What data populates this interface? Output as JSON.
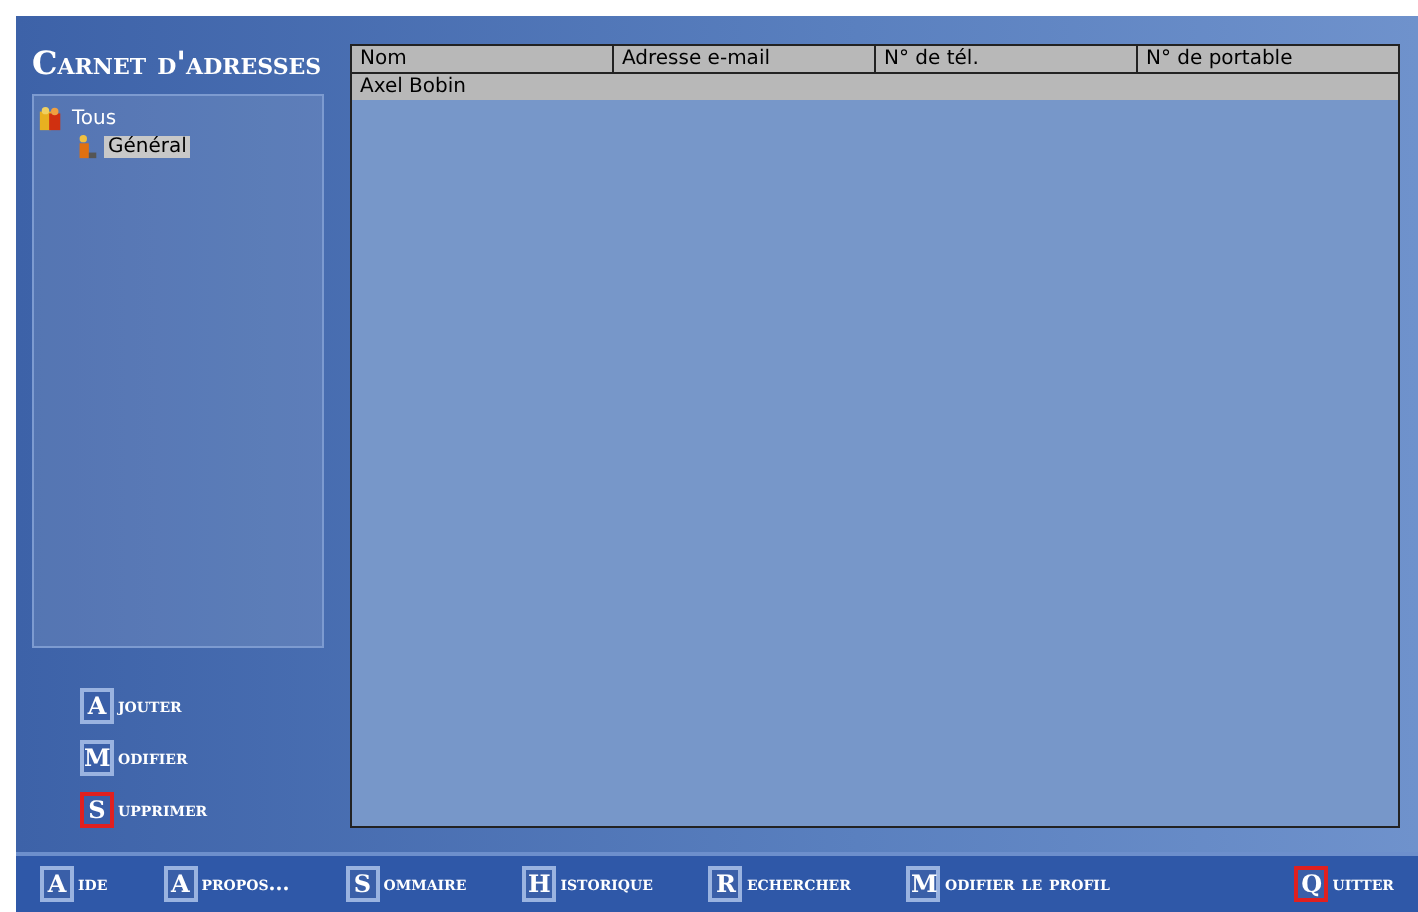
{
  "title": "Carnet d'adresses",
  "tree": [
    {
      "label": "Tous",
      "selected": false,
      "children": [
        {
          "label": "Général",
          "selected": true
        }
      ]
    }
  ],
  "actions": [
    {
      "key": "A",
      "rest": "jouter",
      "kind": "normal"
    },
    {
      "key": "M",
      "rest": "odifier",
      "kind": "normal"
    },
    {
      "key": "S",
      "rest": "upprimer",
      "kind": "danger"
    }
  ],
  "table": {
    "columns": [
      "Nom",
      "Adresse e-mail",
      "N° de tél.",
      "N° de portable"
    ],
    "rows": [
      {
        "cells": [
          "Axel Bobin",
          "",
          "",
          ""
        ],
        "selected": true
      }
    ]
  },
  "bottom_bar": [
    {
      "key": "A",
      "rest": "ide",
      "kind": "normal"
    },
    {
      "key": "A",
      "rest": "propos...",
      "kind": "normal"
    },
    {
      "key": "S",
      "rest": "ommaire",
      "kind": "normal"
    },
    {
      "key": "H",
      "rest": "istorique",
      "kind": "normal"
    },
    {
      "key": "R",
      "rest": "echercher",
      "kind": "normal"
    },
    {
      "key": "M",
      "rest": "odifier le profil",
      "kind": "normal"
    },
    {
      "key": "Q",
      "rest": "uitter",
      "kind": "danger"
    }
  ]
}
